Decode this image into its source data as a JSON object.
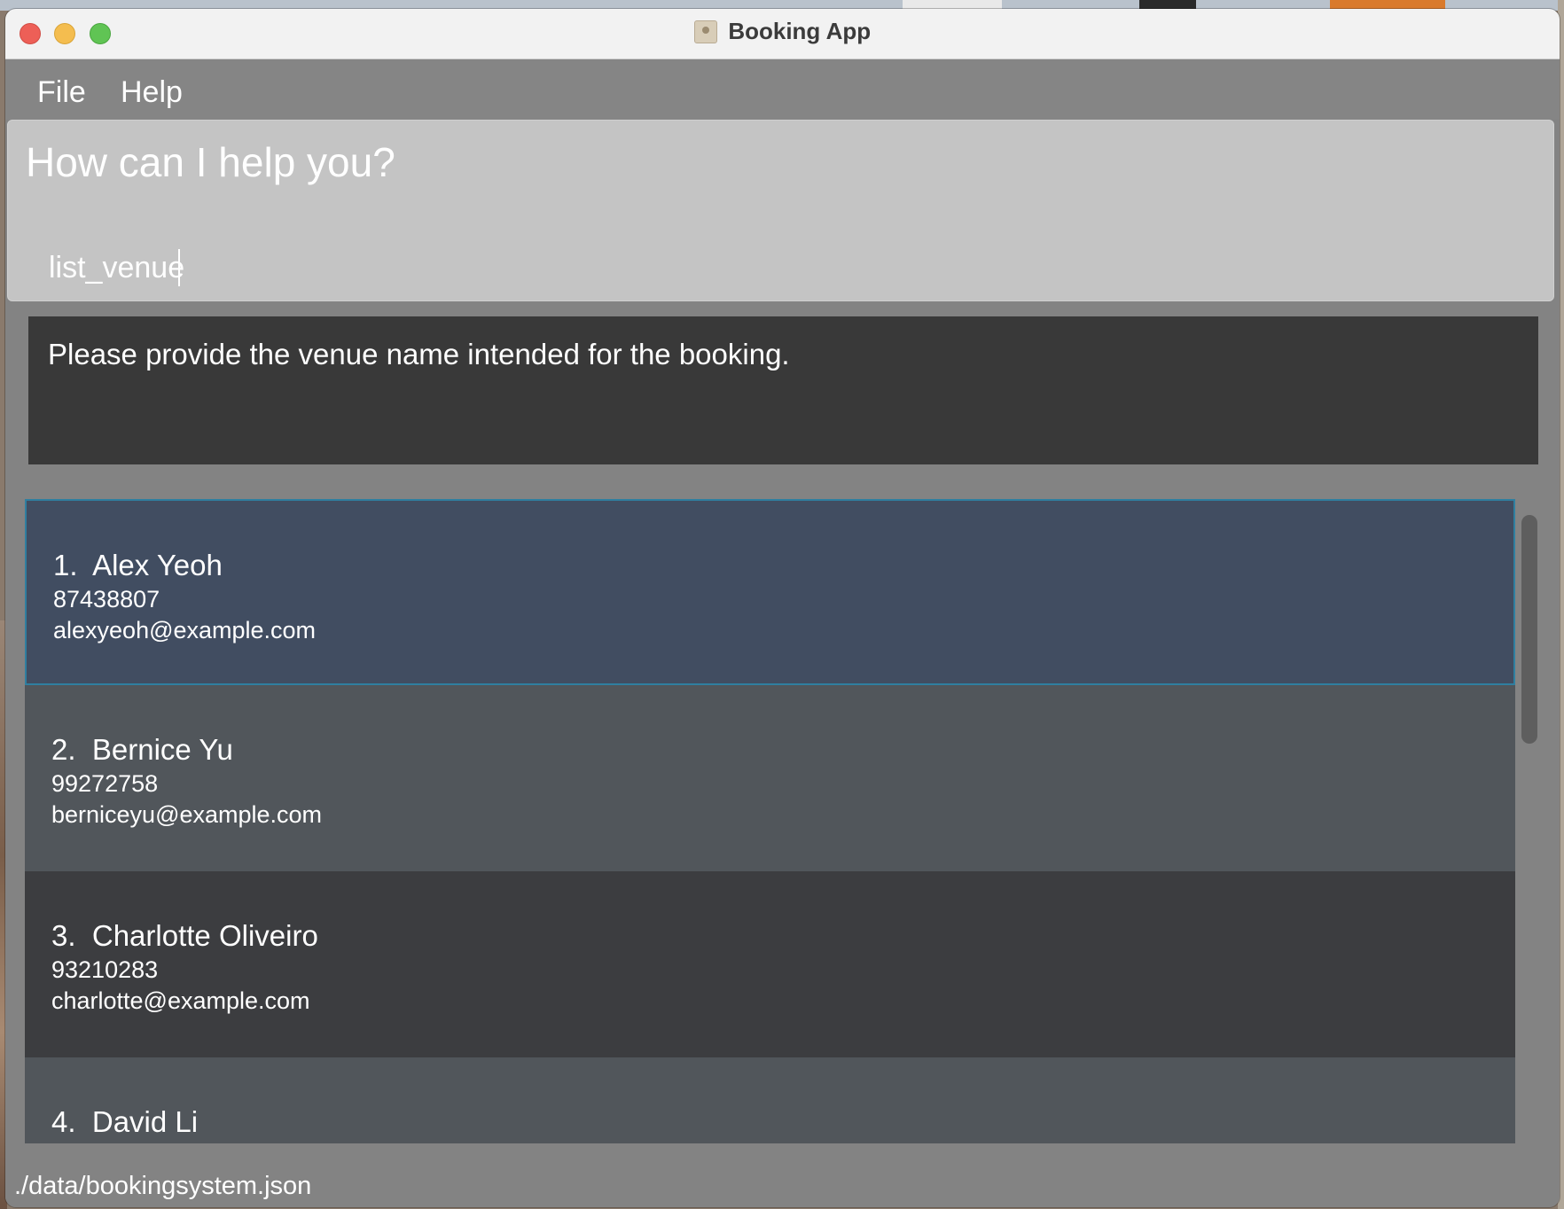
{
  "window": {
    "title": "Booking App"
  },
  "menu": {
    "file": "File",
    "help": "Help"
  },
  "command": {
    "prompt": "How can I help you?",
    "value": "list_venue"
  },
  "result": {
    "message": "Please provide the venue name intended for the booking."
  },
  "people": [
    {
      "index": "1.",
      "name": "Alex Yeoh",
      "phone": "87438807",
      "email": "alexyeoh@example.com"
    },
    {
      "index": "2.",
      "name": "Bernice Yu",
      "phone": "99272758",
      "email": "berniceyu@example.com"
    },
    {
      "index": "3.",
      "name": "Charlotte Oliveiro",
      "phone": "93210283",
      "email": "charlotte@example.com"
    },
    {
      "index": "4.",
      "name": "David Li",
      "phone": "",
      "email": ""
    }
  ],
  "status": {
    "file_path": "./data/bookingsystem.json"
  },
  "colors": {
    "selected_card": "#414d61",
    "card_alt_light": "#51565b",
    "card_alt_dark": "#3c3d40",
    "result_bg": "#393939",
    "command_bg": "#c4c4c4"
  }
}
